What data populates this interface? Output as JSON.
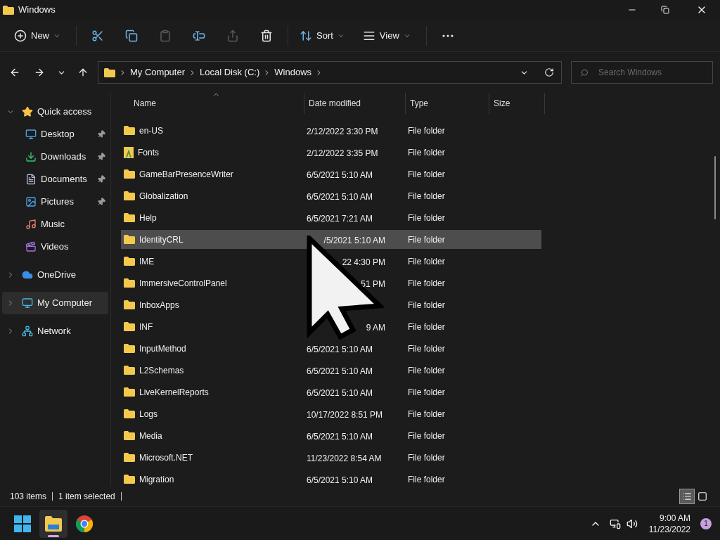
{
  "window": {
    "title": "Windows"
  },
  "toolbar": [
    {
      "kind": "new",
      "label": "New",
      "disabled": false
    },
    {
      "kind": "cut",
      "disabled": false
    },
    {
      "kind": "copy",
      "disabled": false
    },
    {
      "kind": "paste",
      "disabled": true
    },
    {
      "kind": "rename",
      "disabled": false
    },
    {
      "kind": "share",
      "disabled": true
    },
    {
      "kind": "delete",
      "disabled": false
    },
    {
      "kind": "sort",
      "label": "Sort",
      "disabled": false
    },
    {
      "kind": "view",
      "label": "View",
      "disabled": false
    },
    {
      "kind": "more",
      "disabled": false
    }
  ],
  "address": {
    "segments": [
      "My Computer",
      "Local Disk (C:)",
      "Windows"
    ]
  },
  "search": {
    "placeholder": "Search Windows"
  },
  "sidebar": [
    {
      "kind": "star",
      "label": "Quick access",
      "expanded": true,
      "selected": false,
      "children": [
        {
          "kind": "desktop",
          "label": "Desktop",
          "pinned": true,
          "selected": false
        },
        {
          "kind": "download",
          "label": "Downloads",
          "pinned": true,
          "selected": false
        },
        {
          "kind": "documents",
          "label": "Documents",
          "pinned": true,
          "selected": false
        },
        {
          "kind": "pictures",
          "label": "Pictures",
          "pinned": true,
          "selected": false
        },
        {
          "kind": "music",
          "label": "Music",
          "pinned": false,
          "selected": false
        },
        {
          "kind": "videos",
          "label": "Videos",
          "pinned": false,
          "selected": false
        }
      ]
    },
    {
      "kind": "cloud",
      "label": "OneDrive",
      "expanded": false,
      "selected": false
    },
    {
      "kind": "computer",
      "label": "My Computer",
      "expanded": false,
      "selected": true
    },
    {
      "kind": "network",
      "label": "Network",
      "expanded": false,
      "selected": false
    }
  ],
  "table": {
    "columns": [
      {
        "label": "Name",
        "sorted": true
      },
      {
        "label": "Date modified"
      },
      {
        "label": "Type"
      },
      {
        "label": "Size"
      }
    ],
    "rows": [
      {
        "kind": "folder",
        "name": "en-US",
        "date": "2/12/2022 3:30 PM",
        "type": "File folder",
        "selected": false,
        "obscured": false
      },
      {
        "kind": "fonts",
        "name": "Fonts",
        "date": "2/12/2022 3:35 PM",
        "type": "File folder",
        "selected": false,
        "obscured": false
      },
      {
        "kind": "folder",
        "name": "GameBarPresenceWriter",
        "date": "6/5/2021 5:10 AM",
        "type": "File folder",
        "selected": false,
        "obscured": false
      },
      {
        "kind": "folder",
        "name": "Globalization",
        "date": "6/5/2021 5:10 AM",
        "type": "File folder",
        "selected": false,
        "obscured": false
      },
      {
        "kind": "folder",
        "name": "Help",
        "date": "6/5/2021 7:21 AM",
        "type": "File folder",
        "selected": false,
        "obscured": false
      },
      {
        "kind": "folder",
        "name": "IdentityCRL",
        "date": "/5/2021 5:10 AM",
        "type": "File folder",
        "selected": true,
        "obscured": true
      },
      {
        "kind": "folder",
        "name": "IME",
        "date": "22 4:30 PM",
        "type": "File folder",
        "selected": false,
        "obscured": true
      },
      {
        "kind": "folder",
        "name": "ImmersiveControlPanel",
        "date": "51 PM",
        "type": "File folder",
        "selected": false,
        "obscured": true
      },
      {
        "kind": "folder",
        "name": "InboxApps",
        "type": "File folder",
        "selected": false
      },
      {
        "kind": "folder",
        "name": "INF",
        "date": "9 AM",
        "type": "File folder",
        "selected": false,
        "obscured": true
      },
      {
        "kind": "folder",
        "name": "InputMethod",
        "date": "6/5/2021 5:10 AM",
        "type": "File folder",
        "selected": false,
        "obscured": false
      },
      {
        "kind": "folder",
        "name": "L2Schemas",
        "date": "6/5/2021 5:10 AM",
        "type": "File folder",
        "selected": false,
        "obscured": false
      },
      {
        "kind": "folder",
        "name": "LiveKernelReports",
        "date": "6/5/2021 5:10 AM",
        "type": "File folder",
        "selected": false,
        "obscured": false
      },
      {
        "kind": "folder",
        "name": "Logs",
        "date": "10/17/2022 8:51 PM",
        "type": "File folder",
        "selected": false,
        "obscured": false
      },
      {
        "kind": "folder",
        "name": "Media",
        "date": "6/5/2021 5:10 AM",
        "type": "File folder",
        "selected": false,
        "obscured": false
      },
      {
        "kind": "folder",
        "name": "Microsoft.NET",
        "date": "11/23/2022 8:54 AM",
        "type": "File folder",
        "selected": false,
        "obscured": false
      },
      {
        "kind": "folder",
        "name": "Migration",
        "date": "6/5/2021 5:10 AM",
        "type": "File folder",
        "selected": false,
        "obscured": false
      }
    ]
  },
  "status_bar": {
    "count": "103 items",
    "selection": "1 item selected",
    "views": [
      {
        "kind": "details",
        "selected": true
      },
      {
        "kind": "tiles",
        "selected": false
      }
    ]
  },
  "taskbar": {
    "apps": [
      {
        "kind": "start",
        "active": false
      },
      {
        "kind": "explorer",
        "active": true
      },
      {
        "kind": "chrome",
        "active": false
      }
    ],
    "time": "9:00 AM",
    "date": "11/23/2022",
    "notifications": "1"
  }
}
